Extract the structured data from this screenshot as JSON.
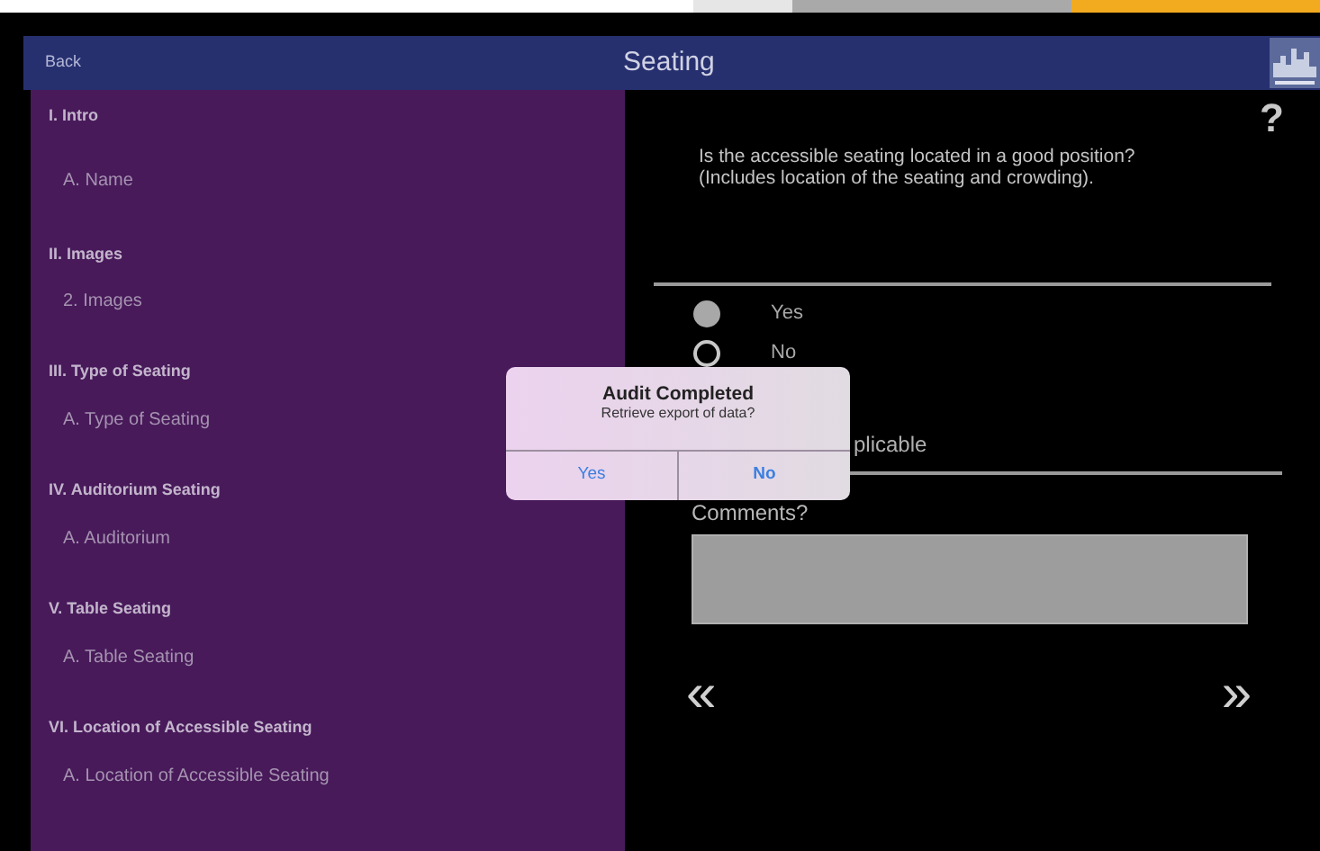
{
  "nav": {
    "back": "Back",
    "title": "Seating"
  },
  "sidebar": {
    "sections": [
      {
        "label": "I. Intro",
        "children": [
          {
            "label": "A. Name"
          }
        ]
      },
      {
        "label": "II. Images",
        "children": [
          {
            "label": "2. Images"
          }
        ]
      },
      {
        "label": "III. Type of Seating",
        "children": [
          {
            "label": "A. Type of Seating"
          }
        ]
      },
      {
        "label": "IV. Auditorium Seating",
        "children": [
          {
            "label": "A. Auditorium"
          }
        ]
      },
      {
        "label": "V. Table Seating",
        "children": [
          {
            "label": "A. Table Seating"
          }
        ]
      },
      {
        "label": "VI. Location of Accessible Seating",
        "children": [
          {
            "label": "A. Location of Accessible Seating"
          }
        ]
      }
    ]
  },
  "help": "?",
  "question": "Is the accessible seating located in a good position? (Includes location of the seating and crowding).",
  "options": [
    {
      "label": "Yes",
      "selected": true
    },
    {
      "label": "No",
      "selected": false
    }
  ],
  "partial_option_text": "plicable",
  "comments": {
    "label": "Comments?"
  },
  "pager": {
    "previous": "«",
    "next": "»"
  },
  "dialog": {
    "title": "Audit Completed",
    "message": "Retrieve export of data?",
    "buttons": [
      "Yes",
      "No"
    ]
  }
}
